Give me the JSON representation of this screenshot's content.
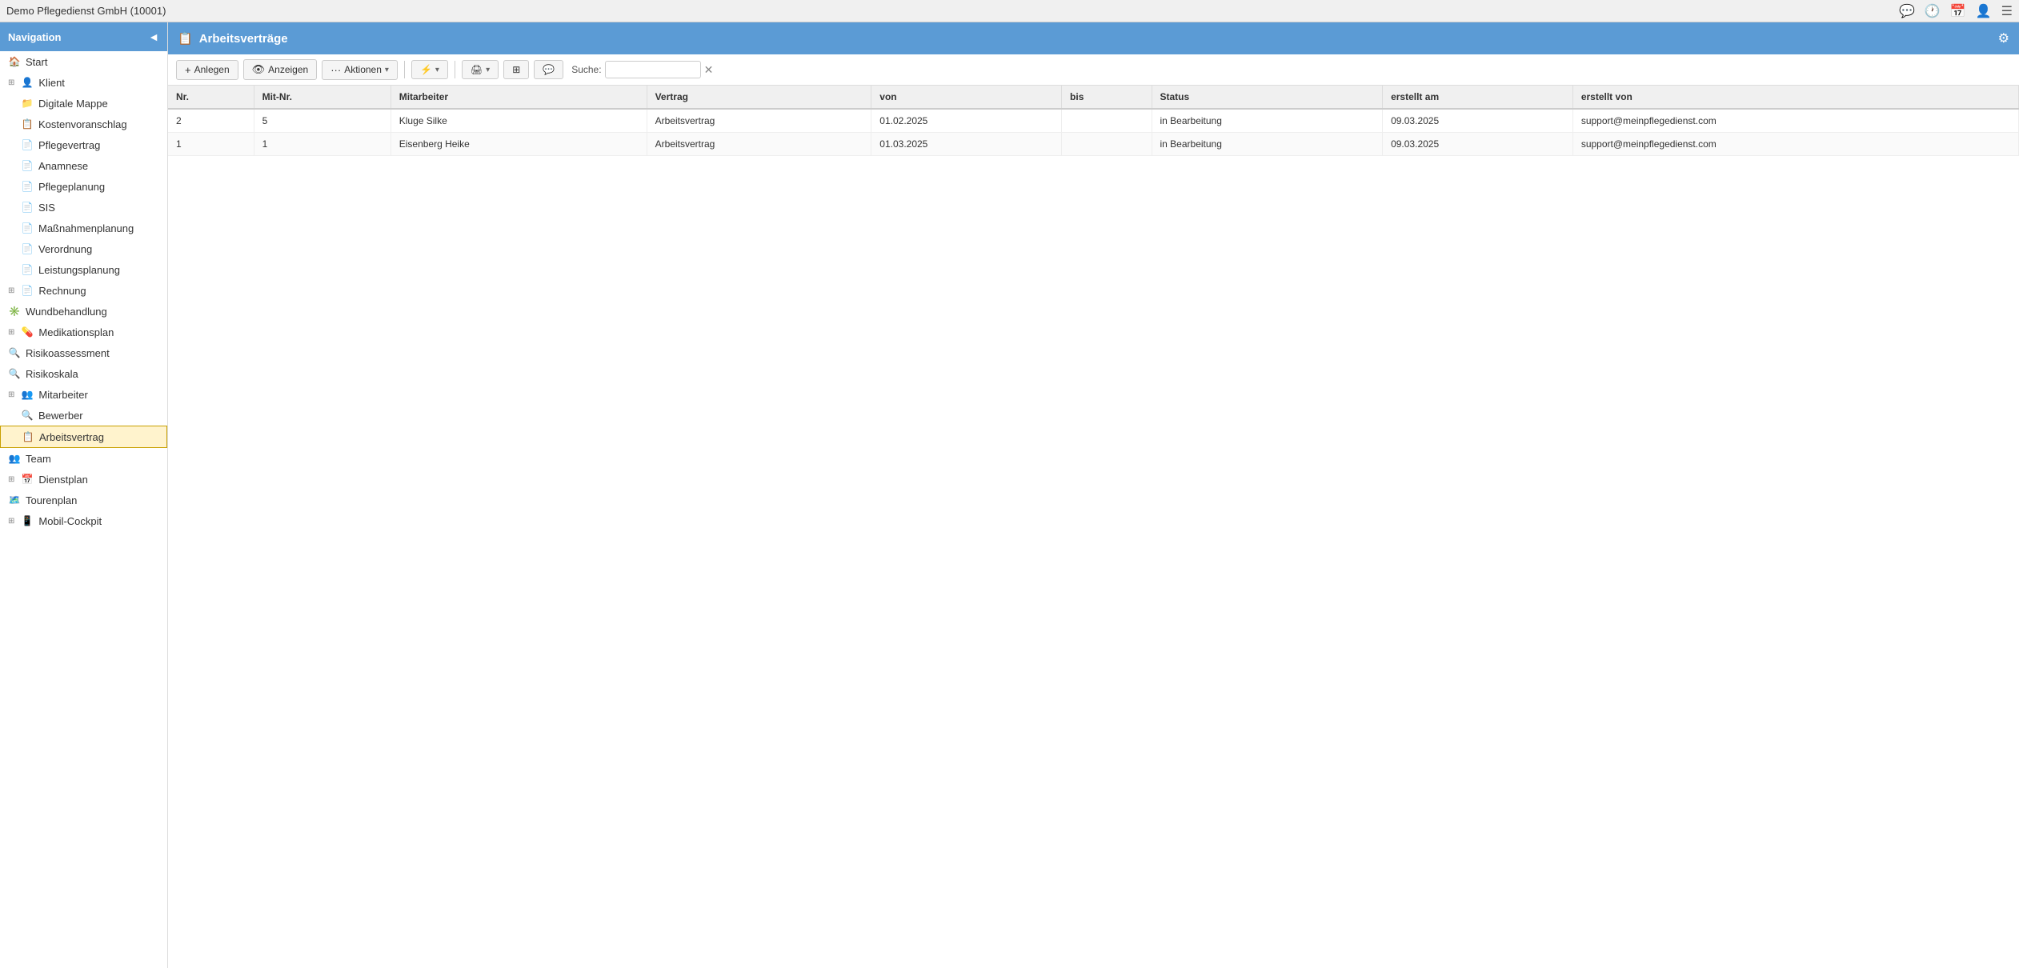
{
  "titlebar": {
    "title": "Demo Pflegedienst GmbH (10001)",
    "icons": [
      "chat-icon",
      "history-icon",
      "calendar-icon",
      "user-icon",
      "menu-icon"
    ]
  },
  "sidebar": {
    "header": "Navigation",
    "collapse_char": "◄",
    "items": [
      {
        "id": "start",
        "label": "Start",
        "icon": "🏠",
        "indent": 0,
        "expandable": false
      },
      {
        "id": "klient",
        "label": "Klient",
        "icon": "👤",
        "indent": 0,
        "expandable": true
      },
      {
        "id": "digitale-mappe",
        "label": "Digitale Mappe",
        "icon": "📁",
        "indent": 1,
        "expandable": false
      },
      {
        "id": "kostenvoranschlag",
        "label": "Kostenvoranschlag",
        "icon": "📋",
        "indent": 1,
        "expandable": false
      },
      {
        "id": "pflegevertrag",
        "label": "Pflegevertrag",
        "icon": "📄",
        "indent": 1,
        "expandable": false
      },
      {
        "id": "anamnese",
        "label": "Anamnese",
        "icon": "📄",
        "indent": 1,
        "expandable": false
      },
      {
        "id": "pflegeplanung",
        "label": "Pflegeplanung",
        "icon": "📄",
        "indent": 1,
        "expandable": false
      },
      {
        "id": "sis",
        "label": "SIS",
        "icon": "📄",
        "indent": 1,
        "expandable": false
      },
      {
        "id": "massnahmenplanung",
        "label": "Maßnahmenplanung",
        "icon": "📄",
        "indent": 1,
        "expandable": false
      },
      {
        "id": "verordnung",
        "label": "Verordnung",
        "icon": "📄",
        "indent": 1,
        "expandable": false
      },
      {
        "id": "leistungsplanung",
        "label": "Leistungsplanung",
        "icon": "📄",
        "indent": 1,
        "expandable": false
      },
      {
        "id": "rechnung",
        "label": "Rechnung",
        "icon": "📄",
        "indent": 0,
        "expandable": true
      },
      {
        "id": "wundbehandlung",
        "label": "Wundbehandlung",
        "icon": "✳️",
        "indent": 0,
        "expandable": false
      },
      {
        "id": "medikationsplan",
        "label": "Medikationsplan",
        "icon": "💊",
        "indent": 0,
        "expandable": true
      },
      {
        "id": "risikoassessment",
        "label": "Risikoassessment",
        "icon": "🔍",
        "indent": 0,
        "expandable": false
      },
      {
        "id": "risikoskala",
        "label": "Risikoskala",
        "icon": "🔍",
        "indent": 0,
        "expandable": false
      },
      {
        "id": "mitarbeiter",
        "label": "Mitarbeiter",
        "icon": "👥",
        "indent": 0,
        "expandable": true
      },
      {
        "id": "bewerber",
        "label": "Bewerber",
        "icon": "🔍",
        "indent": 1,
        "expandable": false
      },
      {
        "id": "arbeitsvertrag",
        "label": "Arbeitsvertrag",
        "icon": "📋",
        "indent": 1,
        "expandable": false,
        "active": true
      },
      {
        "id": "team",
        "label": "Team",
        "icon": "👥",
        "indent": 0,
        "expandable": false
      },
      {
        "id": "dienstplan",
        "label": "Dienstplan",
        "icon": "📅",
        "indent": 0,
        "expandable": true
      },
      {
        "id": "tourenplan",
        "label": "Tourenplan",
        "icon": "🗺️",
        "indent": 0,
        "expandable": false
      },
      {
        "id": "mobil-cockpit",
        "label": "Mobil-Cockpit",
        "icon": "📱",
        "indent": 0,
        "expandable": true
      }
    ]
  },
  "main": {
    "page_title": "Arbeitsverträge",
    "page_icon": "📋",
    "toolbar": {
      "anlegen_label": "Anlegen",
      "anzeigen_label": "Anzeigen",
      "aktionen_label": "Aktionen",
      "filter_label": "",
      "print_label": "",
      "export_label": "",
      "comment_label": "",
      "search_label": "Suche:"
    },
    "table": {
      "columns": [
        "Nr.",
        "Mit-Nr.",
        "Mitarbeiter",
        "Vertrag",
        "von",
        "bis",
        "Status",
        "erstellt am",
        "erstellt von"
      ],
      "rows": [
        {
          "nr": "2",
          "mit_nr": "5",
          "mitarbeiter": "Kluge Silke",
          "vertrag": "Arbeitsvertrag",
          "von": "01.02.2025",
          "bis": "",
          "status": "in Bearbeitung",
          "erstellt_am": "09.03.2025",
          "erstellt_von": "support@meinpflegedienst.com"
        },
        {
          "nr": "1",
          "mit_nr": "1",
          "mitarbeiter": "Eisenberg Heike",
          "vertrag": "Arbeitsvertrag",
          "von": "01.03.2025",
          "bis": "",
          "status": "in Bearbeitung",
          "erstellt_am": "09.03.2025",
          "erstellt_von": "support@meinpflegedienst.com"
        }
      ]
    }
  }
}
